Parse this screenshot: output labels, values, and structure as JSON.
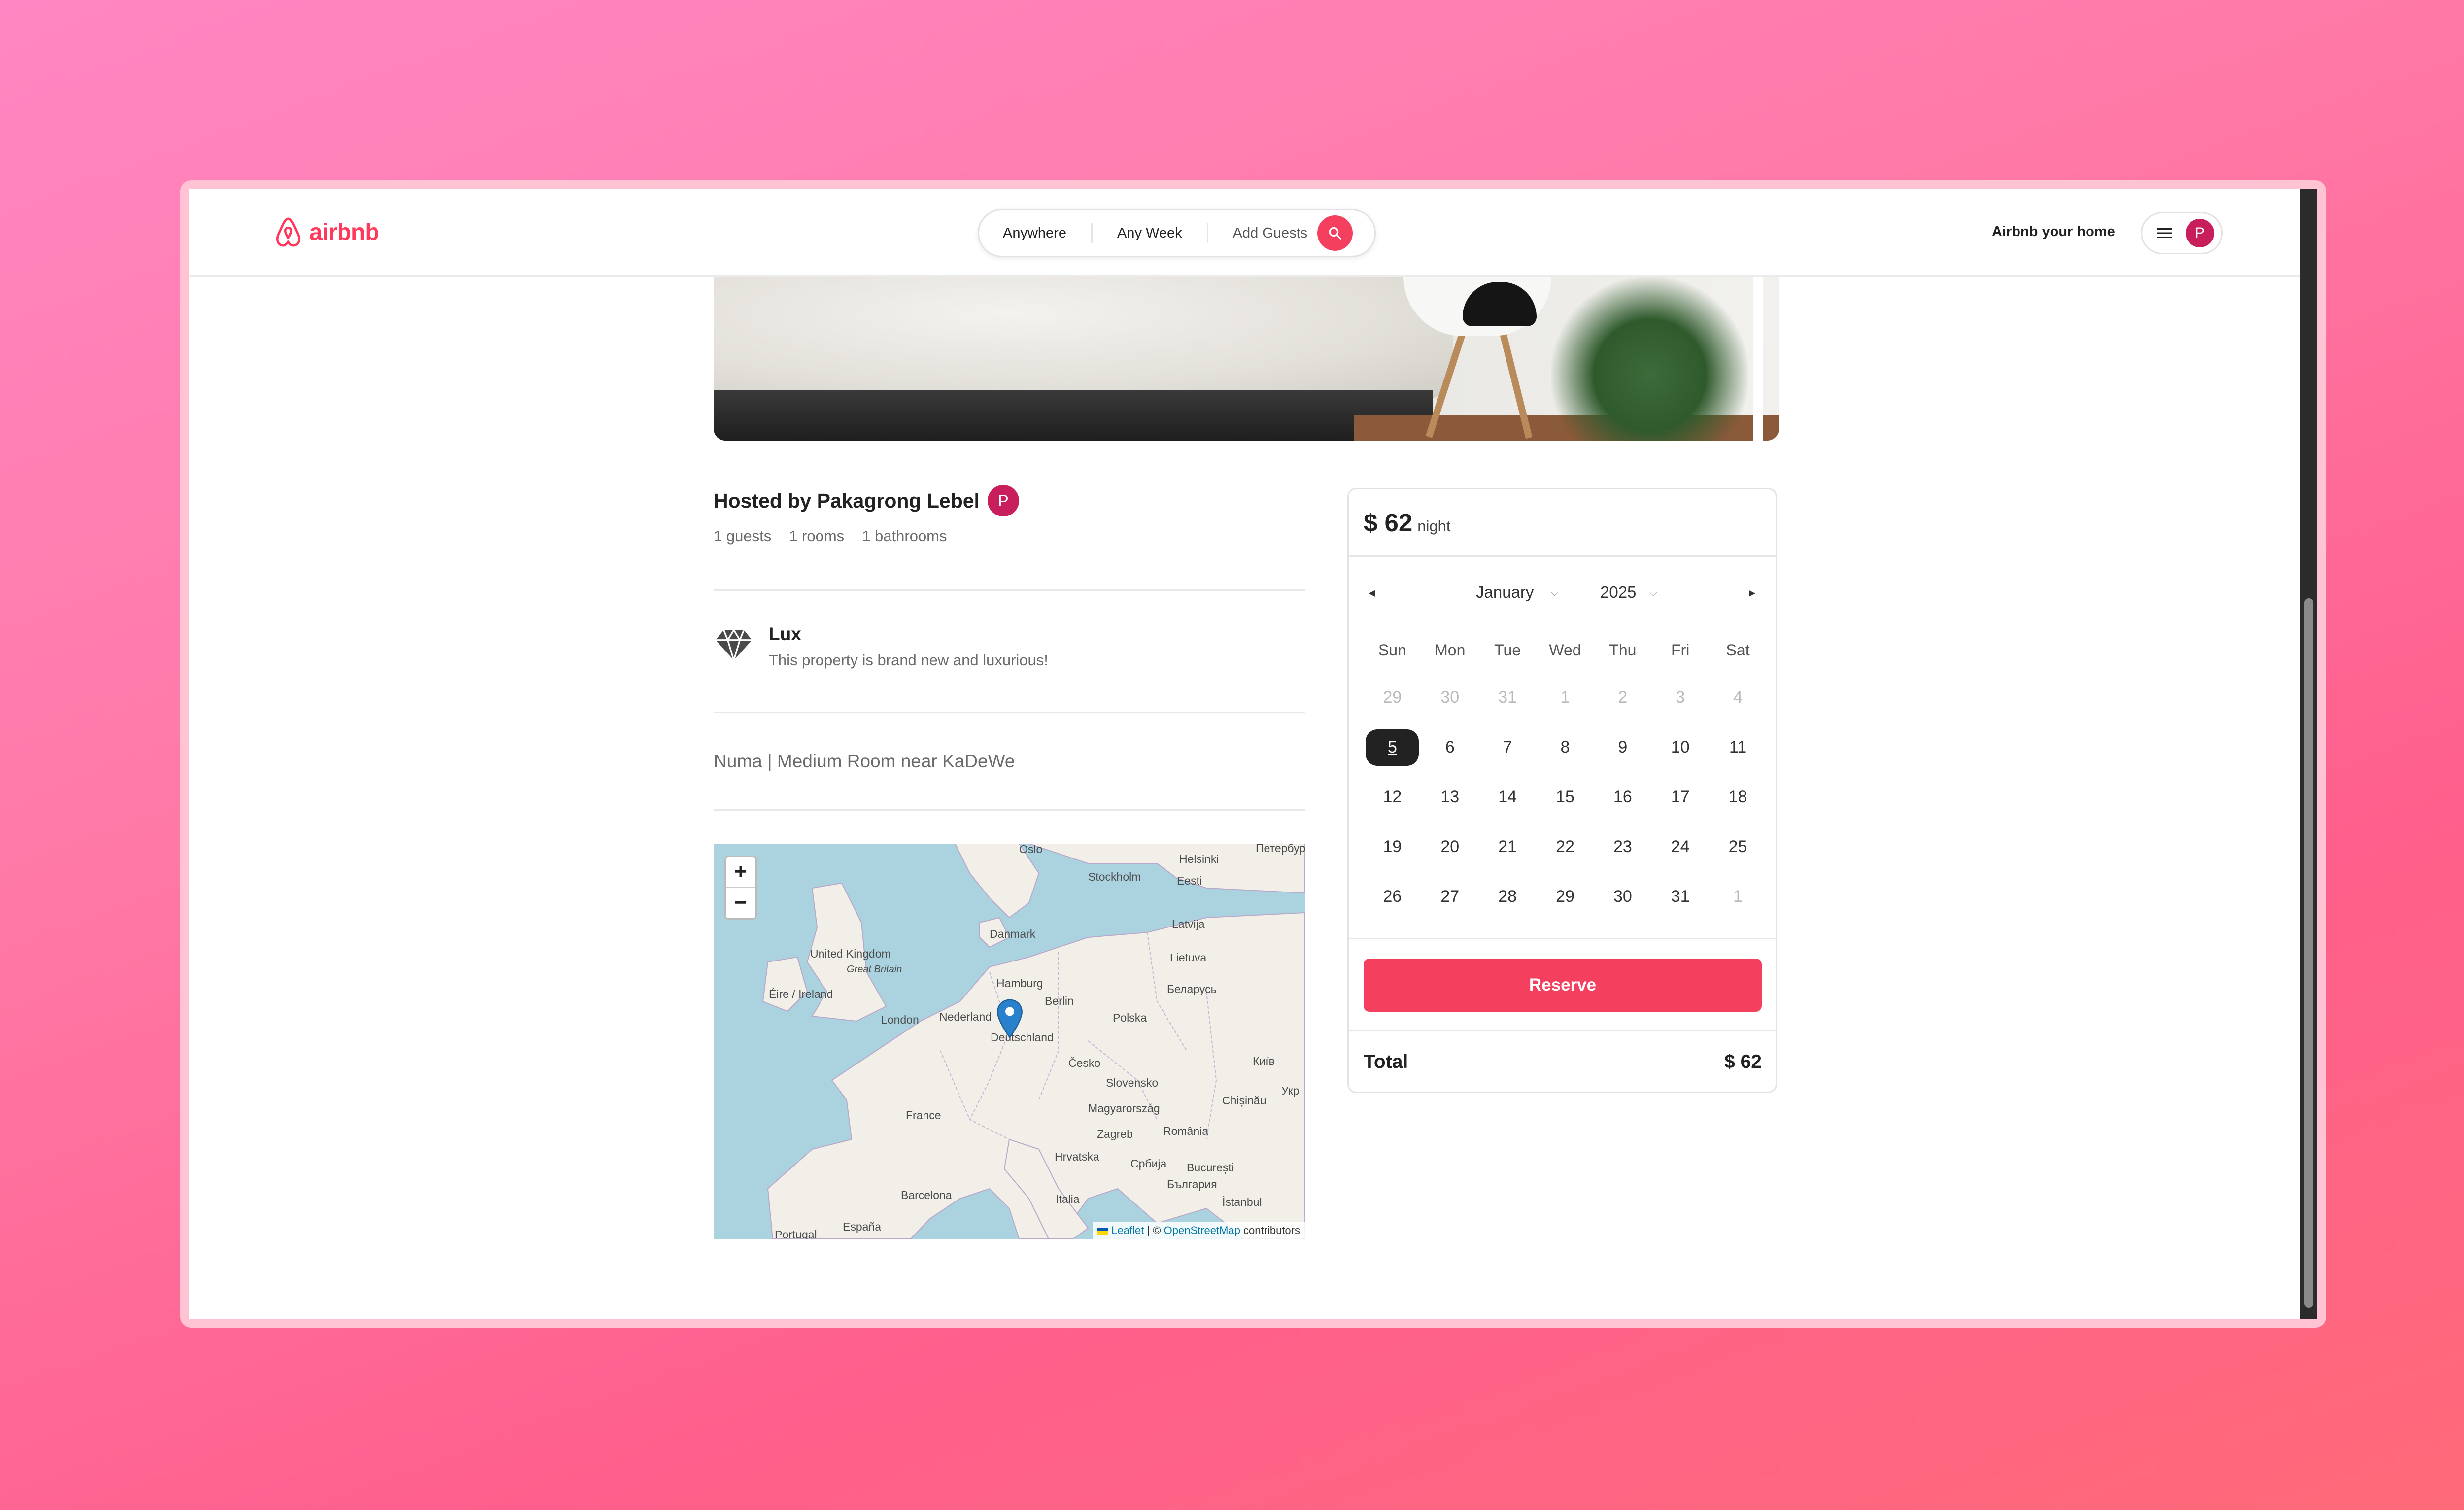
{
  "header": {
    "logo_text": "airbnb",
    "search": {
      "location": "Anywhere",
      "week": "Any Week",
      "guests": "Add Guests"
    },
    "host_link": "Airbnb your home",
    "avatar_initial": "P"
  },
  "listing": {
    "host_title": "Hosted by Pakagrong Lebel",
    "host_initial": "P",
    "stats": [
      "1 guests",
      "1 rooms",
      "1 bathrooms"
    ],
    "feature": {
      "title": "Lux",
      "description": "This property is brand new and luxurious!"
    },
    "name": "Numa | Medium Room near KaDeWe"
  },
  "map": {
    "zoom_in": "+",
    "zoom_out": "−",
    "labels": {
      "oslo": "Oslo",
      "helsinki": "Helsinki",
      "petersburg": "Петербург",
      "stockholm": "Stockholm",
      "eesti": "Eesti",
      "danmark": "Danmark",
      "latvija": "Latvija",
      "uk": "United Kingdom",
      "great_britain": "Great Britain",
      "lietuva": "Lietuva",
      "hamburg": "Hamburg",
      "eire": "Éire / Ireland",
      "berlin": "Berlin",
      "belarus": "Беларусь",
      "london": "London",
      "nederland": "Nederland",
      "polska": "Polska",
      "deutschland": "Deutschland",
      "cesko": "Česko",
      "kyiv": "Київ",
      "ukr": "Укр",
      "slovensko": "Slovensko",
      "france": "France",
      "chisinau": "Chișinău",
      "magyarorszag": "Magyarország",
      "zagreb": "Zagreb",
      "romania": "România",
      "hrvatska": "Hrvatska",
      "bucuresti": "București",
      "srbija": "Србија",
      "bulgaria": "България",
      "barcelona": "Barcelona",
      "italia": "Italia",
      "istanbul": "İstanbul",
      "espana": "España",
      "portugal": "Portugal"
    },
    "attribution": {
      "leaflet": "Leaflet",
      "sep": " | © ",
      "osm": "OpenStreetMap",
      "contrib": " contributors"
    }
  },
  "booking": {
    "price": "$ 62",
    "price_unit": "night",
    "month": "January",
    "year": "2025",
    "weekdays": [
      "Sun",
      "Mon",
      "Tue",
      "Wed",
      "Thu",
      "Fri",
      "Sat"
    ],
    "days": [
      [
        "29",
        "30",
        "31",
        "1",
        "2",
        "3",
        "4"
      ],
      [
        "5",
        "6",
        "7",
        "8",
        "9",
        "10",
        "11"
      ],
      [
        "12",
        "13",
        "14",
        "15",
        "16",
        "17",
        "18"
      ],
      [
        "19",
        "20",
        "21",
        "22",
        "23",
        "24",
        "25"
      ],
      [
        "26",
        "27",
        "28",
        "29",
        "30",
        "31",
        "1"
      ]
    ],
    "selected_day": "5",
    "reserve_label": "Reserve",
    "total_label": "Total",
    "total_value": "$ 62"
  },
  "colors": {
    "brand": "#ff385c",
    "reserve": "#f43f5e",
    "avatar": "#c81e5b",
    "map_pin": "#2a81cb"
  }
}
